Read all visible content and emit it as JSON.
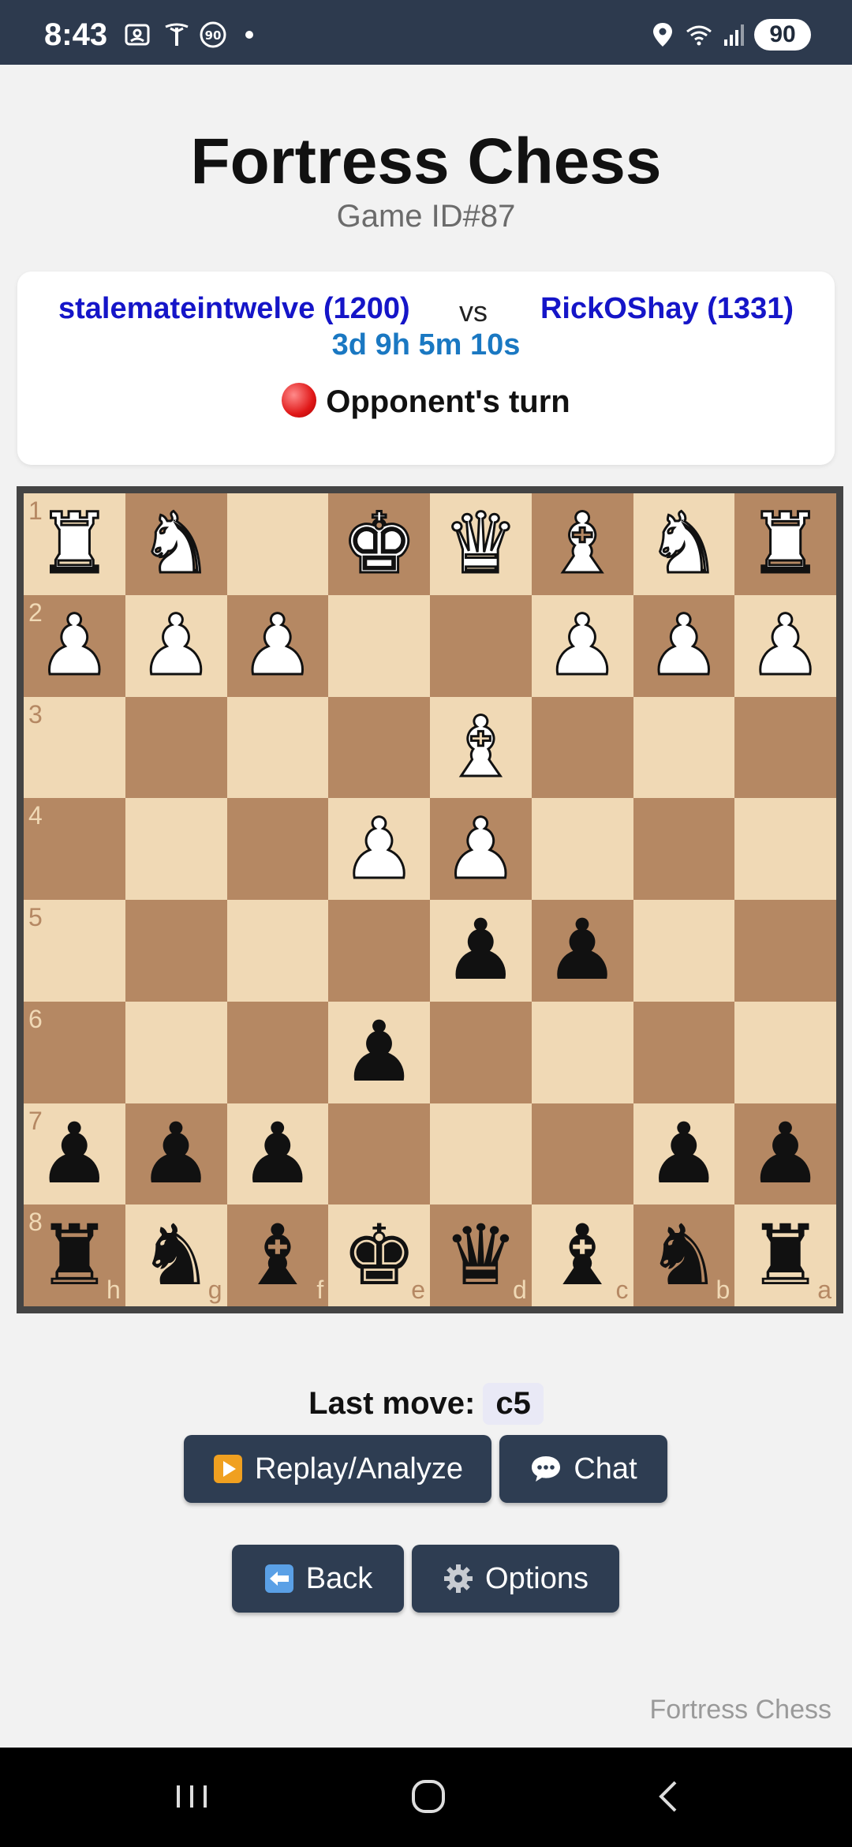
{
  "status_bar": {
    "time": "8:43",
    "battery": "90"
  },
  "header": {
    "title": "Fortress Chess",
    "game_id": "Game ID#87"
  },
  "match": {
    "player1": "stalemateintwelve (1200)",
    "vs": "vs",
    "player2": "RickOShay (1331)",
    "timer": "3d 9h 5m 10s",
    "turn_status": "Opponent's turn",
    "turn_indicator_color": "#e01818"
  },
  "board": {
    "orientation": "black-at-bottom",
    "rank_labels": [
      "1",
      "2",
      "3",
      "4",
      "5",
      "6",
      "7",
      "8"
    ],
    "file_labels": [
      "h",
      "g",
      "f",
      "e",
      "d",
      "c",
      "b",
      "a"
    ],
    "colors": {
      "light": "#f0d9b5",
      "dark": "#b58863"
    },
    "rows": [
      [
        {
          "p": "♜",
          "c": "white"
        },
        {
          "p": "♞",
          "c": "white"
        },
        null,
        {
          "p": "♚",
          "c": "white"
        },
        {
          "p": "♛",
          "c": "white"
        },
        {
          "p": "♝",
          "c": "white"
        },
        {
          "p": "♞",
          "c": "white"
        },
        {
          "p": "♜",
          "c": "white"
        }
      ],
      [
        {
          "p": "♟",
          "c": "white"
        },
        {
          "p": "♟",
          "c": "white"
        },
        {
          "p": "♟",
          "c": "white"
        },
        null,
        null,
        {
          "p": "♟",
          "c": "white"
        },
        {
          "p": "♟",
          "c": "white"
        },
        {
          "p": "♟",
          "c": "white"
        }
      ],
      [
        null,
        null,
        null,
        null,
        {
          "p": "♝",
          "c": "white"
        },
        null,
        null,
        null
      ],
      [
        null,
        null,
        null,
        {
          "p": "♟",
          "c": "white"
        },
        {
          "p": "♟",
          "c": "white"
        },
        null,
        null,
        null
      ],
      [
        null,
        null,
        null,
        null,
        {
          "p": "♟",
          "c": "black"
        },
        {
          "p": "♟",
          "c": "black"
        },
        null,
        null
      ],
      [
        null,
        null,
        null,
        {
          "p": "♟",
          "c": "black"
        },
        null,
        null,
        null,
        null
      ],
      [
        {
          "p": "♟",
          "c": "black"
        },
        {
          "p": "♟",
          "c": "black"
        },
        {
          "p": "♟",
          "c": "black"
        },
        null,
        null,
        null,
        {
          "p": "♟",
          "c": "black"
        },
        {
          "p": "♟",
          "c": "black"
        }
      ],
      [
        {
          "p": "♜",
          "c": "black"
        },
        {
          "p": "♞",
          "c": "black"
        },
        {
          "p": "♝",
          "c": "black"
        },
        {
          "p": "♚",
          "c": "black"
        },
        {
          "p": "♛",
          "c": "black"
        },
        {
          "p": "♝",
          "c": "black"
        },
        {
          "p": "♞",
          "c": "black"
        },
        {
          "p": "♜",
          "c": "black"
        }
      ]
    ]
  },
  "last_move": {
    "label": "Last move:",
    "value": "c5"
  },
  "buttons": {
    "replay": "Replay/Analyze",
    "chat": "Chat",
    "back": "Back",
    "options": "Options"
  },
  "footer": {
    "brand": "Fortress Chess"
  }
}
